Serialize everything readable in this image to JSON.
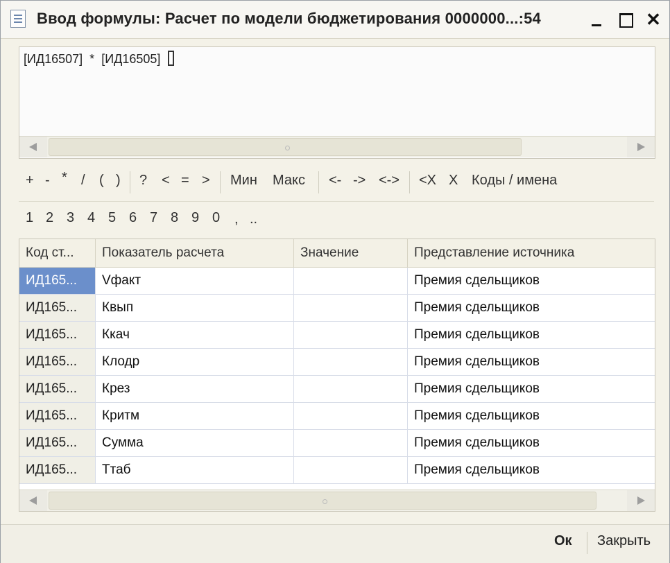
{
  "window": {
    "title": "Ввод формулы: Расчет по модели бюджетирования 0000000...:54",
    "minimize_icon": "minimize-icon",
    "maximize_icon": "maximize-icon",
    "close_icon": "close-icon",
    "close_glyph": "✕"
  },
  "editor": {
    "formula": "[ИД16507]  *  [ИД16505] "
  },
  "operators": [
    "+",
    "-",
    "*",
    "/",
    "(",
    ")",
    "?",
    "<",
    "=",
    ">",
    "Мин",
    "Макс",
    "<-",
    "->",
    "<->",
    "<X",
    "X",
    "Коды / имена"
  ],
  "digits": [
    "1",
    "2",
    "3",
    "4",
    "5",
    "6",
    "7",
    "8",
    "9",
    "0",
    ",",
    ".."
  ],
  "table": {
    "columns": [
      "Код ст...",
      "Показатель расчета",
      "Значение",
      "Представление источника"
    ],
    "rows": [
      {
        "code": "ИД165...",
        "indicator": "Vфакт",
        "value": "",
        "source": "Премия сдельщиков"
      },
      {
        "code": "ИД165...",
        "indicator": "Квып",
        "value": "",
        "source": "Премия сдельщиков"
      },
      {
        "code": "ИД165...",
        "indicator": "Ккач",
        "value": "",
        "source": "Премия сдельщиков"
      },
      {
        "code": "ИД165...",
        "indicator": "Клодр",
        "value": "",
        "source": "Премия сдельщиков"
      },
      {
        "code": "ИД165...",
        "indicator": "Крез",
        "value": "",
        "source": "Премия сдельщиков"
      },
      {
        "code": "ИД165...",
        "indicator": "Критм",
        "value": "",
        "source": "Премия сдельщиков"
      },
      {
        "code": "ИД165...",
        "indicator": "Сумма",
        "value": "",
        "source": "Премия сдельщиков"
      },
      {
        "code": "ИД165...",
        "indicator": "Ттаб",
        "value": "",
        "source": "Премия сдельщиков"
      }
    ]
  },
  "footer": {
    "ok_label": "Ок",
    "close_label": "Закрыть"
  },
  "colors": {
    "selection": "#6b8fcb",
    "panel": "#f4f2e8"
  }
}
